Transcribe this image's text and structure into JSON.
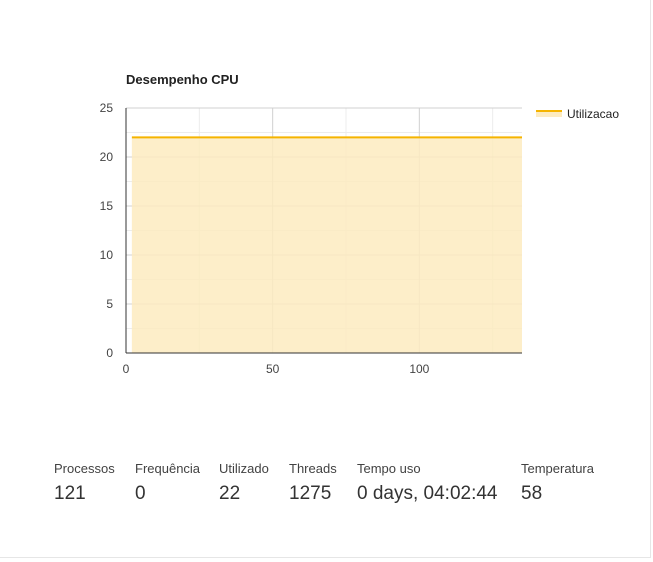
{
  "chart_data": {
    "type": "area",
    "title": "Desempenho CPU",
    "xlabel": "",
    "ylabel": "",
    "xlim": [
      0,
      135
    ],
    "ylim": [
      0,
      25
    ],
    "x_ticks": [
      0,
      50,
      100
    ],
    "y_ticks": [
      0,
      5,
      10,
      15,
      20,
      25
    ],
    "grid": true,
    "legend_position": "right",
    "series": [
      {
        "name": "Utilizacao",
        "color": "#f5b400",
        "fill": "#fdebc0",
        "x": [
          2,
          135
        ],
        "values": [
          22,
          22
        ]
      }
    ]
  },
  "stats": [
    {
      "label": "Processos",
      "value": "121"
    },
    {
      "label": "Frequência",
      "value": "0"
    },
    {
      "label": "Utilizado",
      "value": "22"
    },
    {
      "label": "Threads",
      "value": "1275"
    },
    {
      "label": "Tempo uso",
      "value": "0 days, 04:02:44"
    },
    {
      "label": "Temperatura",
      "value": "58"
    }
  ]
}
